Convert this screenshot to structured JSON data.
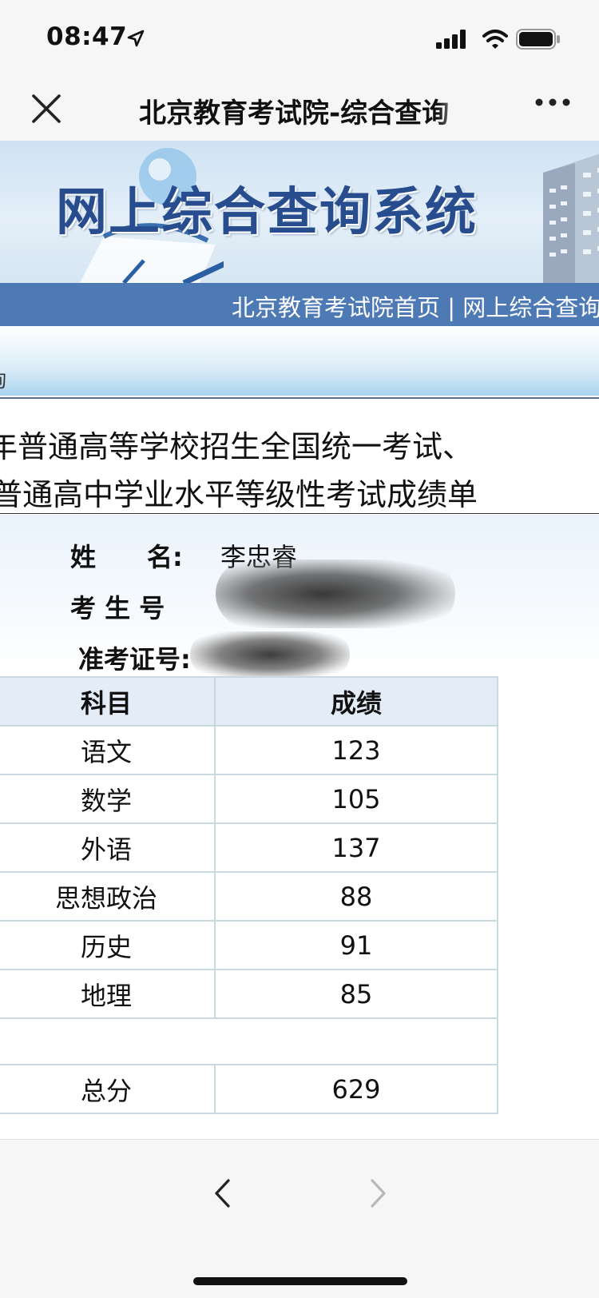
{
  "status_bar": {
    "time": "08:47"
  },
  "nav": {
    "title": "北京教育考试院-综合查询"
  },
  "banner": {
    "title": "网上综合查询系统"
  },
  "link_bar": {
    "text": "北京教育考试院首页 | 网上综合查询"
  },
  "strip": {
    "text": "询"
  },
  "heading": {
    "line1": "年普通高等学校招生全国统一考试、",
    "line2": "普通高中学业水平等级性考试成绩单"
  },
  "student": {
    "name_label": "姓　　名:",
    "name_value": "李忠睿",
    "exam_no_label": "考 生 号",
    "admission_label": "准考证号:"
  },
  "table": {
    "headers": [
      "科目",
      "成绩"
    ],
    "rows": [
      {
        "subject": "语文",
        "score": "123"
      },
      {
        "subject": "数学",
        "score": "105"
      },
      {
        "subject": "外语",
        "score": "137"
      },
      {
        "subject": "思想政治",
        "score": "88"
      },
      {
        "subject": "历史",
        "score": "91"
      },
      {
        "subject": "地理",
        "score": "85"
      }
    ],
    "total_label": "总分",
    "total_value": "629"
  },
  "colors": {
    "link_bar": "#4d79b5",
    "banner_text": "#274d8f",
    "table_border": "#c9d9df"
  },
  "icons": [
    "location-arrow-icon",
    "signal-icon",
    "wifi-icon",
    "battery-icon",
    "close-icon",
    "more-icon",
    "back-icon",
    "forward-icon"
  ]
}
